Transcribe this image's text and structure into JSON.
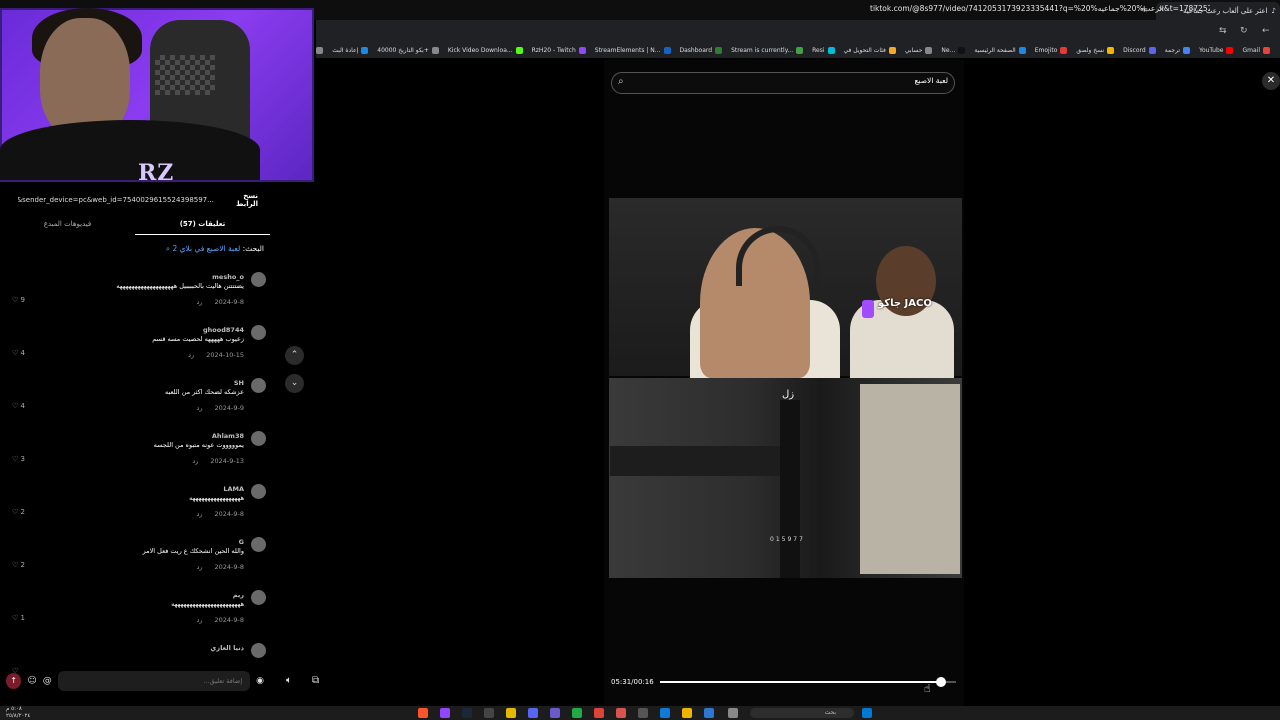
{
  "browser": {
    "active_tab_title": "اعثر على ألعاب رعب جماعية",
    "new_tab": "+",
    "url": "tiktok.com/@8s977/video/7412053173923335441?q=%20%الرعب%20%جماعيه&t=1787252873129",
    "bookmarks": [
      {
        "label": "Gmail",
        "color": "#ea4335"
      },
      {
        "label": "YouTube",
        "color": "#ff0000"
      },
      {
        "label": "ترجمة",
        "color": "#4285f4"
      },
      {
        "label": "Discord",
        "color": "#5865f2"
      },
      {
        "label": "نسخ ولصق",
        "color": "#f4b400"
      },
      {
        "label": "Emojito",
        "color": "#e53935"
      },
      {
        "label": "الصفحة الرئيسية",
        "color": "#1e88e5"
      },
      {
        "label": "Ne...",
        "color": "#111111"
      },
      {
        "label": "حسابي",
        "color": "#888888"
      },
      {
        "label": "فئات التحويل في",
        "color": "#f9a825"
      },
      {
        "label": "Resi",
        "color": "#00bcd4"
      },
      {
        "label": "Stream is currently...",
        "color": "#43a047"
      },
      {
        "label": "Dashboard",
        "color": "#2e7d32"
      },
      {
        "label": "StreamElements | N...",
        "color": "#1565c0"
      },
      {
        "label": "RzH20 - Twitch",
        "color": "#9146ff"
      },
      {
        "label": "Kick Video Downloa...",
        "color": "#53fc18"
      },
      {
        "label": "بكو التاريخ 40000+",
        "color": "#888888"
      },
      {
        "label": "إعادة البث",
        "color": "#1e88e5"
      },
      {
        "label": "حصرية تعريب لعبة",
        "color": "#888888"
      }
    ]
  },
  "webcam": {
    "logo": "RZ"
  },
  "left_panel": {
    "copy_button": "نسخ الرابط",
    "link_text": "...p=1&sender_device=pc&web_id=7540029615524398597",
    "tab_videos": "فيديوهات المبدع",
    "tab_comments": "(57) تعليقات",
    "search_prefix": "البحث:",
    "search_query": "لعبة الاصبع في بلاي 2",
    "comments": [
      {
        "user": "mesho_o",
        "text": "يضتتتتن هاليت بالحببببيل هههههههههههههههههههه",
        "date": "2024-9-8",
        "reply": "رد",
        "likes": "9"
      },
      {
        "user": "ghood8744",
        "text": "زعيوب هههههه لحصيت مسه قسم",
        "date": "2024-10-15",
        "reply": "رد",
        "likes": "4"
      },
      {
        "user": "SH",
        "text": "عزشكه لضحك اكثر من اللعبه",
        "date": "2024-9-9",
        "reply": "رد",
        "likes": "4"
      },
      {
        "user": "Ahlam38",
        "text": "يموووووت عونه متبوه من اللجسه",
        "date": "2024-9-13",
        "reply": "رد",
        "likes": "3"
      },
      {
        "user": "LAMA",
        "text": "هههههههههههههههههه",
        "date": "2024-9-8",
        "reply": "رد",
        "likes": "2"
      },
      {
        "user": "G",
        "text": "والله الحين انشحكك ع ريت فعل الامر",
        "date": "2024-9-8",
        "reply": "رد",
        "likes": "2"
      },
      {
        "user": "ريم",
        "text": "هههههههههههههههههههههههه",
        "date": "2024-9-8",
        "reply": "رد",
        "likes": "1"
      },
      {
        "user": "دنيا الغازي",
        "text": "",
        "date": "",
        "reply": "",
        "likes": ""
      }
    ],
    "comment_placeholder": "إضافة تعليق..."
  },
  "video": {
    "search_text": "لعبة الاصبع",
    "overlay_word": "زل",
    "badge_text": "جاكو JACO",
    "code_text": "015977",
    "time_label": "05:31/00:16",
    "progress": 0.95
  },
  "taskbar": {
    "search_text": "بحث",
    "clock_time": "٥:٠٨ م",
    "clock_date": "٢٥/٨/٢٠٢٤"
  }
}
